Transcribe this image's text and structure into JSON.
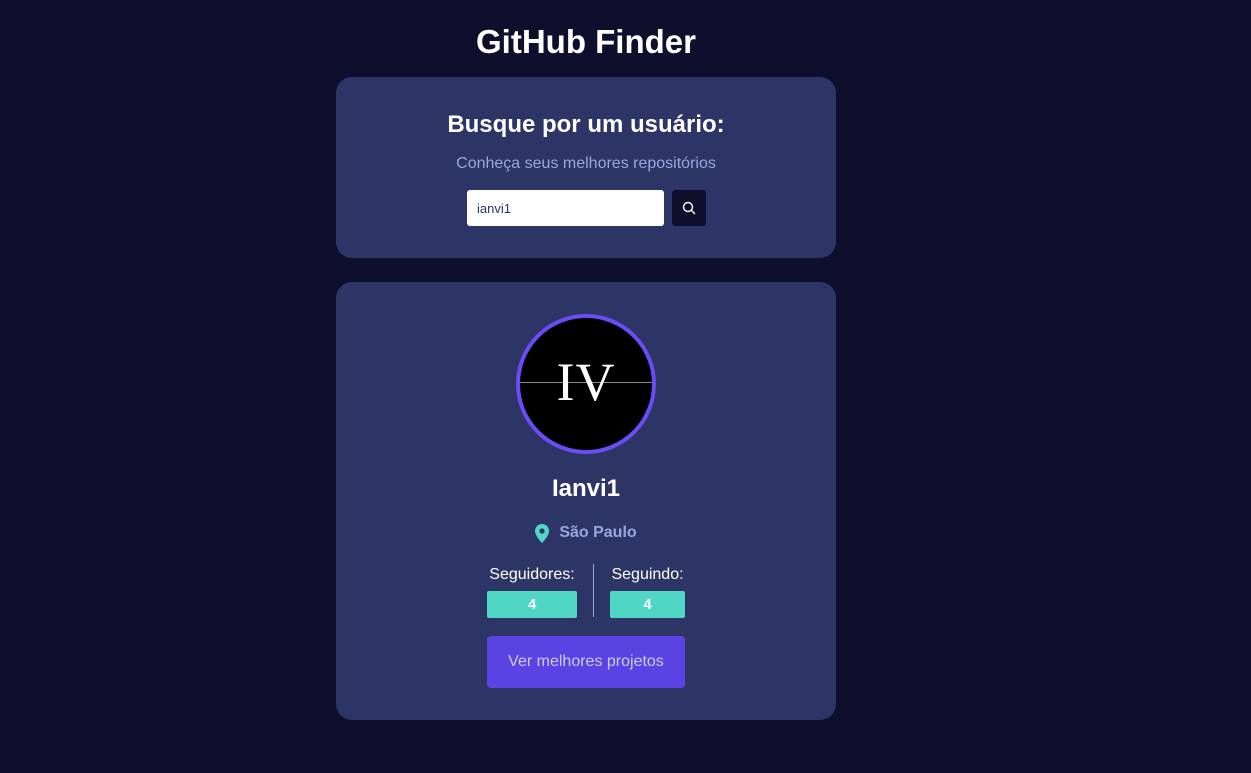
{
  "header": {
    "title": "GitHub Finder"
  },
  "search": {
    "heading": "Busque por um usuário:",
    "subtitle": "Conheça seus melhores repositórios",
    "input_value": "ianvi1",
    "button_icon": "search-icon"
  },
  "profile": {
    "avatar_text": "IV",
    "username": "Ianvi1",
    "location_icon": "map-pin-icon",
    "location": "São Paulo",
    "followers_label": "Seguidores:",
    "followers_count": "4",
    "following_label": "Seguindo:",
    "following_count": "4",
    "cta_label": "Ver melhores projetos"
  },
  "colors": {
    "background": "#0e0f2c",
    "card": "#2d3566",
    "accent_purple": "#5b43e3",
    "accent_teal": "#4fd6c4",
    "muted_text": "#9aa6de"
  }
}
